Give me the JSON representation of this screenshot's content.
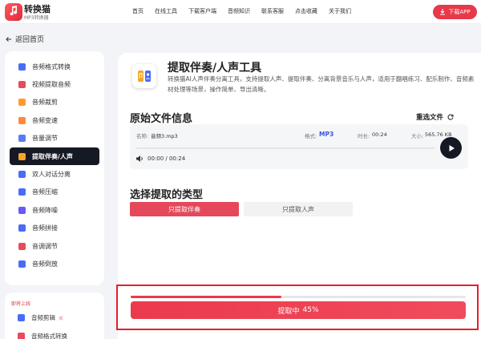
{
  "header": {
    "brand": "转换猫",
    "brand_sub": "MP3转换器",
    "nav": [
      "首页",
      "在线工具",
      "下载客户端",
      "音频知识",
      "联系客服",
      "点击收藏",
      "关于我们"
    ],
    "download_label": "下载APP"
  },
  "back_label": "返回首页",
  "sidebar": {
    "items": [
      {
        "label": "音频格式转换",
        "color": "#4a6cf7"
      },
      {
        "label": "视频提取音频",
        "color": "#e84a5f"
      },
      {
        "label": "音频裁剪",
        "color": "#ff9a2e"
      },
      {
        "label": "音频变速",
        "color": "#ff8a3d"
      },
      {
        "label": "音量调节",
        "color": "#5a7bf6"
      },
      {
        "label": "提取伴奏/人声",
        "color": "#f5a623"
      },
      {
        "label": "双人对话分离",
        "color": "#4a6cf7"
      },
      {
        "label": "音频压缩",
        "color": "#4a6cf7"
      },
      {
        "label": "音频降噪",
        "color": "#6a5af9"
      },
      {
        "label": "音频拼接",
        "color": "#4a6cf7"
      },
      {
        "label": "音调调节",
        "color": "#e84a5f"
      },
      {
        "label": "音频倒放",
        "color": "#4a6cf7"
      }
    ],
    "active_index": 5,
    "new_label": "即将上线",
    "extra_items": [
      {
        "label": "音频剪辑",
        "badge": "火",
        "color": "#4a6cf7"
      },
      {
        "label": "音频格式转换",
        "color": "#e84a5f"
      }
    ]
  },
  "tool": {
    "title": "提取伴奏/人声工具",
    "desc": "转换猫AI人声伴奏分离工具，支持提取人声、提取伴奏、分离背景音乐与人声，适用于翻唱练习、配乐制作、音频素材处理等场景，操作简单、导出清晰。"
  },
  "file": {
    "section_title": "原始文件信息",
    "reselect_label": "重选文件",
    "name_label": "名称:",
    "name": "音频3.mp3",
    "format_label": "格式:",
    "format": "MP3",
    "duration_label": "时长:",
    "duration": "00:24",
    "size_label": "大小:",
    "size": "565.76 KB",
    "time_display": "00:00 / 00:24"
  },
  "extract": {
    "section_title": "选择提取的类型",
    "options": [
      "只提取伴奏",
      "只提取人声"
    ],
    "selected_index": 0
  },
  "progress": {
    "label": "提取中",
    "percent_text": "45%",
    "percent": 45
  },
  "colors": {
    "accent": "#e8394a",
    "dark": "#151924",
    "highlight_border": "#e41f2c",
    "format": "#3b56d9"
  }
}
